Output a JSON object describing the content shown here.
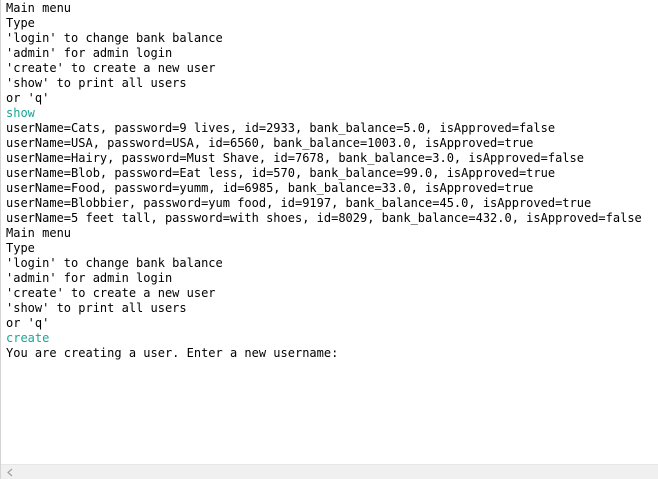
{
  "console": {
    "lines": [
      {
        "text": "Main menu",
        "kind": "output"
      },
      {
        "text": "Type",
        "kind": "output"
      },
      {
        "text": "'login' to change bank balance",
        "kind": "output"
      },
      {
        "text": "'admin' for admin login",
        "kind": "output"
      },
      {
        "text": "'create' to create a new user",
        "kind": "output"
      },
      {
        "text": "'show' to print all users",
        "kind": "output"
      },
      {
        "text": "or 'q'",
        "kind": "output"
      },
      {
        "text": "show",
        "kind": "input"
      },
      {
        "text": "userName=Cats, password=9 lives, id=2933, bank_balance=5.0, isApproved=false",
        "kind": "output"
      },
      {
        "text": "userName=USA, password=USA, id=6560, bank_balance=1003.0, isApproved=true",
        "kind": "output"
      },
      {
        "text": "userName=Hairy, password=Must Shave, id=7678, bank_balance=3.0, isApproved=false",
        "kind": "output"
      },
      {
        "text": "userName=Blob, password=Eat less, id=570, bank_balance=99.0, isApproved=true",
        "kind": "output"
      },
      {
        "text": "userName=Food, password=yumm, id=6985, bank_balance=33.0, isApproved=true",
        "kind": "output"
      },
      {
        "text": "userName=Blobbier, password=yum food, id=9197, bank_balance=45.0, isApproved=true",
        "kind": "output"
      },
      {
        "text": "userName=5 feet tall, password=with shoes, id=8029, bank_balance=432.0, isApproved=false",
        "kind": "output"
      },
      {
        "text": "Main menu",
        "kind": "output"
      },
      {
        "text": "Type",
        "kind": "output"
      },
      {
        "text": "'login' to change bank balance",
        "kind": "output"
      },
      {
        "text": "'admin' for admin login",
        "kind": "output"
      },
      {
        "text": "'create' to create a new user",
        "kind": "output"
      },
      {
        "text": "'show' to print all users",
        "kind": "output"
      },
      {
        "text": "or 'q'",
        "kind": "output"
      },
      {
        "text": "create",
        "kind": "input"
      },
      {
        "text": "You are creating a user. Enter a new username:",
        "kind": "output"
      }
    ]
  },
  "scrollbar": {
    "left_arrow_icon": "chevron-left-icon"
  },
  "colors": {
    "user_input": "#1aa595",
    "program_output": "#000000",
    "background": "#ffffff"
  }
}
